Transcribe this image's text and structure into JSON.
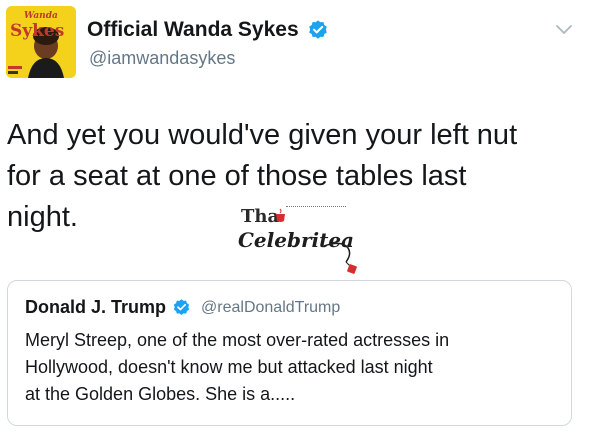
{
  "tweet": {
    "author": {
      "display_name": "Official Wanda Sykes",
      "handle": "@iamwandasykes",
      "verified": true,
      "avatar_text_top": "Wanda",
      "avatar_text_main": "Sykes"
    },
    "text_lines": [
      "And yet you would've given your left nut",
      "for a seat at one of those tables last",
      "night."
    ]
  },
  "watermark": {
    "top": "Tha",
    "bottom": "Celebritea"
  },
  "quoted_tweet": {
    "author": {
      "display_name": "Donald J. Trump",
      "handle": "@realDonaldTrump",
      "verified": true
    },
    "text_lines": [
      "Meryl Streep, one of the most over-rated actresses in",
      "Hollywood, doesn't know me but attacked last night",
      "at the Golden Globes. She is a....."
    ]
  },
  "icons": {
    "verified": "verified-badge-icon",
    "menu": "chevron-down-icon"
  },
  "colors": {
    "verified_blue": "#1da1f2",
    "handle_gray": "#657786",
    "border_gray": "#cfd9de",
    "avatar_yellow": "#f4d21c"
  }
}
